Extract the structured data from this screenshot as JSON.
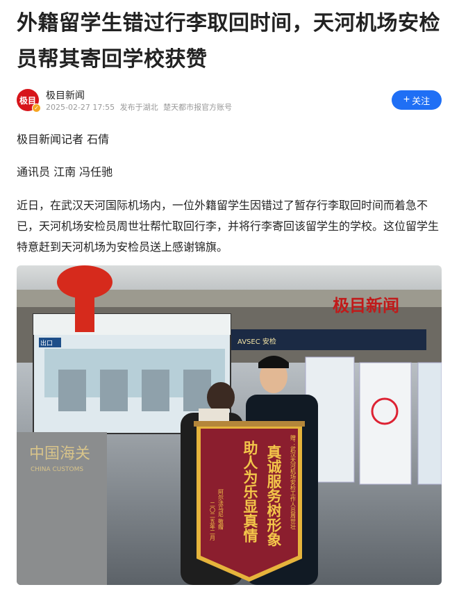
{
  "article": {
    "title": "外籍留学生错过行李取回时间，天河机场安检员帮其寄回学校获赞",
    "author": {
      "avatar_text": "极目",
      "name": "极目新闻",
      "date": "2025-02-27 17:55",
      "location": "发布于湖北",
      "source": "楚天都市报官方账号",
      "follow_label": "关注",
      "follow_icon": "plus-icon"
    },
    "reporter": "极目新闻记者 石倩",
    "correspondent": "通讯员 江南 冯任驰",
    "body": "近日，在武汉天河国际机场内，一位外籍留学生因错过了暂存行李取回时间而着急不已，天河机场安检员周世壮帮忙取回行李，并将行李寄回该留学生的学校。这位留学生特意赶到天河机场为安检员送上感谢锦旗。"
  },
  "photo": {
    "watermark": "极目新闻",
    "sign_customs_cn": "中国海关",
    "sign_customs_en": "CHINA CUSTOMS",
    "sign_avsec": "AVSEC 安检",
    "exit_sign": "出口",
    "banner_line1": "真诚服务树形象",
    "banner_line2": "助人为乐显真情",
    "banner_dedication": "赠：武汉天河机场安检工作人员周世壮",
    "banner_giver": "阿尔法马尼 敬赠",
    "banner_date": "二〇二五年二月"
  },
  "colors": {
    "follow_button": "#1f6ff5",
    "avatar_bg": "#d7151b",
    "banner": "#8b1e2e",
    "banner_text": "#f3c64a"
  }
}
